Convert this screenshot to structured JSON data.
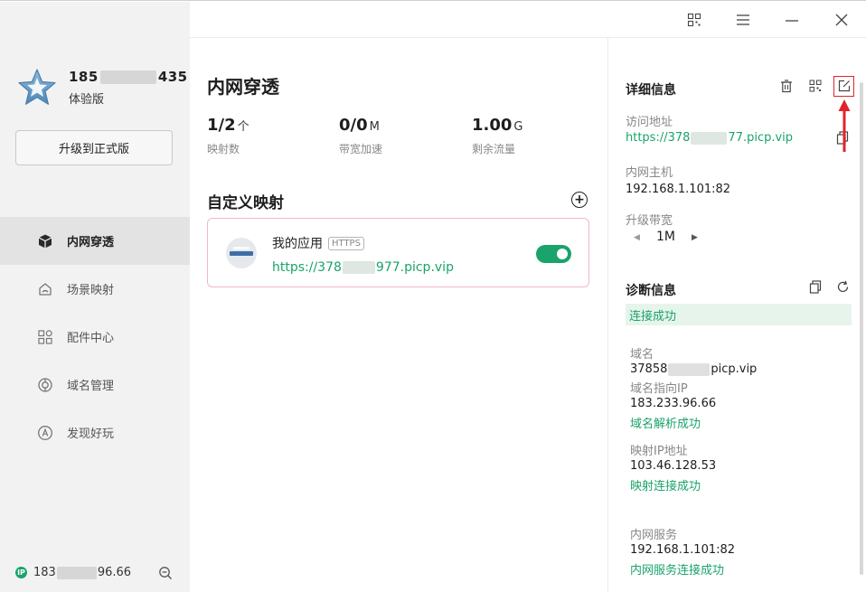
{
  "window": {
    "controls": {
      "qr": "qr-code-icon",
      "menu": "menu-icon",
      "minimize": "minimize-icon",
      "close": "close-icon"
    }
  },
  "sidebar": {
    "user": {
      "name_prefix": "185",
      "name_suffix": "435",
      "tier": "体验版"
    },
    "upgrade_label": "升级到正式版",
    "nav": [
      {
        "label": "内网穿透",
        "icon": "cube-icon",
        "active": true
      },
      {
        "label": "场景映射",
        "icon": "scene-icon",
        "active": false
      },
      {
        "label": "配件中心",
        "icon": "accessory-icon",
        "active": false
      },
      {
        "label": "域名管理",
        "icon": "domain-icon",
        "active": false
      },
      {
        "label": "发现好玩",
        "icon": "discover-icon",
        "active": false
      }
    ],
    "footer": {
      "ip_badge": "IP",
      "ip_prefix": "183",
      "ip_suffix": "96.66"
    }
  },
  "main": {
    "title": "内网穿透",
    "stats": [
      {
        "value": "1/2",
        "unit": "个",
        "label": "映射数"
      },
      {
        "value": "0/0",
        "unit": "M",
        "label": "带宽加速"
      },
      {
        "value": "1.00",
        "unit": "G",
        "label": "剩余流量"
      }
    ],
    "section_title": "自定义映射",
    "add_symbol": "+",
    "mapping": {
      "name": "我的应用",
      "protocol": "HTTPS",
      "url_prefix": "https://378",
      "url_suffix": "977.picp.vip",
      "enabled": true
    }
  },
  "detail": {
    "title": "详细信息",
    "access_label": "访问地址",
    "access_prefix": "https://378",
    "access_suffix": "77.picp.vip",
    "host_label": "内网主机",
    "host_value": "192.168.1.101:82",
    "bandwidth_label": "升级带宽",
    "bandwidth_value": "1M",
    "bandwidth_dec": "◀",
    "bandwidth_inc": "▶"
  },
  "diagnosis": {
    "title": "诊断信息",
    "status": "连接成功",
    "domain_label": "域名",
    "domain_prefix": "37858",
    "domain_suffix": "picp.vip",
    "domain_ip_label": "域名指向IP",
    "domain_ip_value": "183.233.96.66",
    "domain_ip_status": "域名解析成功",
    "mapping_ip_label": "映射IP地址",
    "mapping_ip_value": "103.46.128.53",
    "mapping_ip_status": "映射连接成功",
    "service_label": "内网服务",
    "service_value": "192.168.1.101:82",
    "service_status": "内网服务连接成功"
  },
  "colors": {
    "accent": "#1aa36a",
    "highlight": "#e0242a",
    "card_border": "#f3b6cb",
    "sidebar_bg": "#f2f2f2"
  }
}
